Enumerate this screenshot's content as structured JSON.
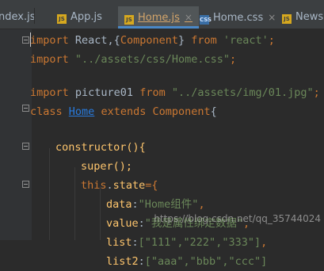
{
  "tabs": [
    {
      "label": "ndex.js",
      "type": "js"
    },
    {
      "label": "App.js",
      "type": "js"
    },
    {
      "label": "Home.js",
      "type": "js",
      "active": true
    },
    {
      "label": "Home.css",
      "type": "css"
    },
    {
      "label": "News",
      "type": "js"
    }
  ],
  "file_icon_text": {
    "js": "JS",
    "css": "CSS"
  },
  "close_glyph": "×",
  "code": {
    "l1": {
      "kw1": "import",
      "a": " React,{",
      "b": "Component",
      "c": "} ",
      "kw2": "from",
      "sp": " ",
      "str": "'react'",
      "end": ";"
    },
    "l2": {
      "kw1": "import",
      "sp": " ",
      "str": "\"../assets/css/Home.css\"",
      "end": ";"
    },
    "l4": {
      "kw1": "import",
      "a": " picture01 ",
      "kw2": "from",
      "sp": " ",
      "str": "\"../assets/img/01.jpg\"",
      "end": ";"
    },
    "l5": {
      "kw1": "class",
      "sp1": " ",
      "name": "Home",
      "sp2": " ",
      "kw2": "extends",
      "sp3": " ",
      "base": "Component",
      "end": "{"
    },
    "l7": {
      "text": "constructor(){"
    },
    "l8": {
      "text": "super();"
    },
    "l9": {
      "kw": "this",
      "a": ".",
      "prop": "state",
      "b": "={"
    },
    "l10": {
      "key": "data",
      "colon": ":",
      "str": "\"Home组件\"",
      "end": ","
    },
    "l11": {
      "key": "value",
      "colon": ":",
      "str": "\"我是属性绑定数据\"",
      "end": ","
    },
    "l12": {
      "key": "list",
      "colon": ":",
      "str": "[\"111\",\"222\",\"333\"]",
      "end": ","
    },
    "l13": {
      "key": "list2",
      "colon": ":",
      "str": "[\"aaa\",\"bbb\",\"ccc\"]"
    }
  },
  "watermark": "https://blog.csdn.net/qq_35744024",
  "colors": {
    "background": "#2b2b2b",
    "keyword": "#cc7832",
    "string": "#6a8759",
    "property": "#ffc66d",
    "link": "#287bde",
    "active_tab_border": "#4a88c7"
  }
}
